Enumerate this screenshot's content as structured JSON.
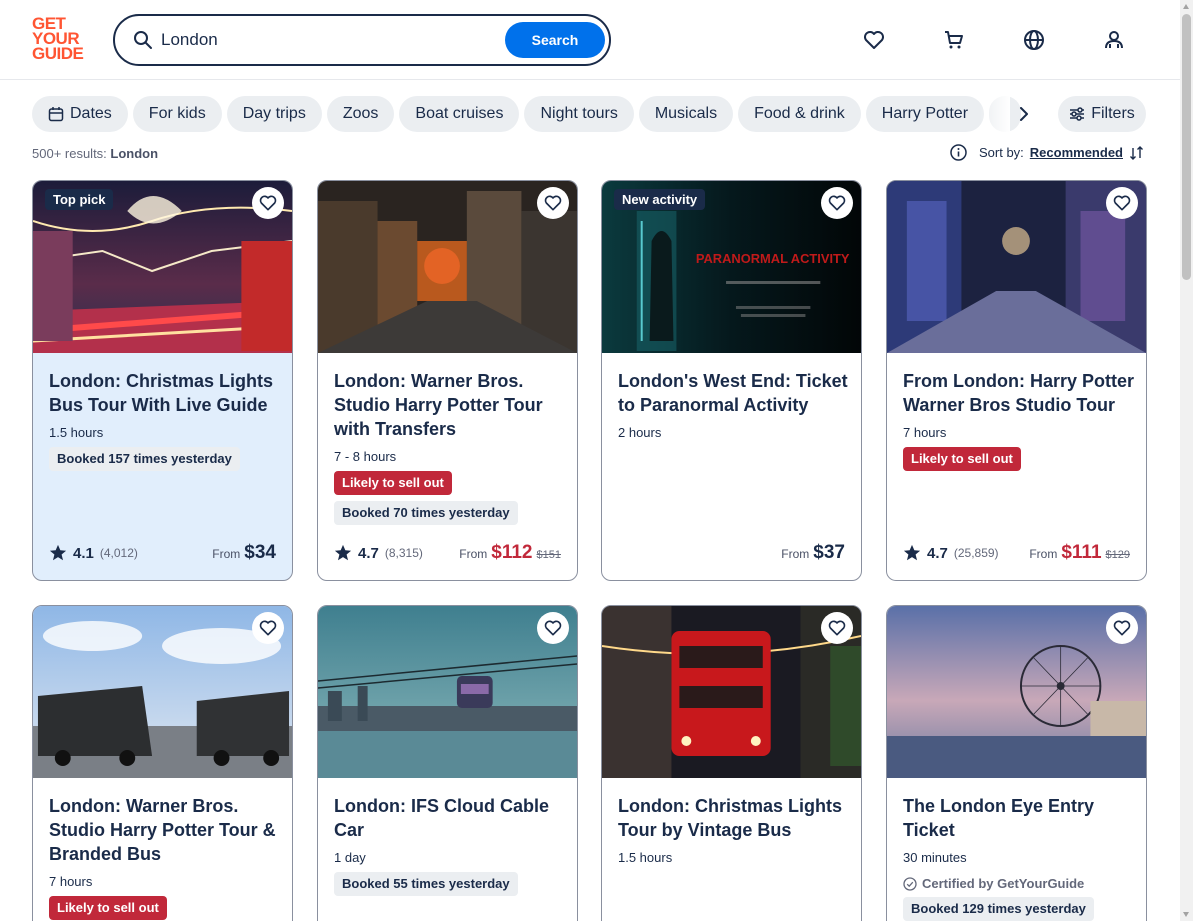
{
  "header": {
    "logo_lines": [
      "GET",
      "YOUR",
      "GUIDE"
    ],
    "search_value": "London",
    "search_button": "Search",
    "icons": [
      "heart-icon",
      "cart-icon",
      "globe-icon",
      "account-icon"
    ]
  },
  "chips": [
    {
      "label": "Dates",
      "icon": "calendar-icon"
    },
    {
      "label": "For kids"
    },
    {
      "label": "Day trips"
    },
    {
      "label": "Zoos"
    },
    {
      "label": "Boat cruises"
    },
    {
      "label": "Night tours"
    },
    {
      "label": "Musicals"
    },
    {
      "label": "Food & drink"
    },
    {
      "label": "Harry Potter"
    }
  ],
  "filters_label": "Filters",
  "results": {
    "count": "500+ results:",
    "query": "London"
  },
  "sort": {
    "label": "Sort by:",
    "value": "Recommended"
  },
  "colors": {
    "brand": "#ff5533",
    "primary": "#0071eb",
    "danger": "#c1283a",
    "text": "#1a2b49",
    "highlight": "#e1eefc"
  },
  "cards": [
    {
      "tag": "Top pick",
      "title": "London: Christmas Lights Bus Tour With Live Guide",
      "duration": "1.5 hours",
      "booked": "Booked 157 times yesterday",
      "rating": "4.1",
      "reviews": "(4,012)",
      "from": "From",
      "price": "$34"
    },
    {
      "title": "London: Warner Bros. Studio Harry Potter Tour with Transfers",
      "duration": "7 - 8 hours",
      "sellout": "Likely to sell out",
      "booked": "Booked 70 times yesterday",
      "rating": "4.7",
      "reviews": "(8,315)",
      "from": "From",
      "price": "$112",
      "old_price": "$151"
    },
    {
      "tag": "New activity",
      "title": "London's West End: Ticket to Paranormal Activity",
      "duration": "2 hours",
      "from": "From",
      "price": "$37",
      "poster_text": "PARANORMAL ACTIVITY"
    },
    {
      "title": "From London: Harry Potter Warner Bros Studio Tour",
      "duration": "7 hours",
      "sellout": "Likely to sell out",
      "rating": "4.7",
      "reviews": "(25,859)",
      "from": "From",
      "price": "$111",
      "old_price": "$129"
    },
    {
      "title": "London: Warner Bros. Studio Harry Potter Tour & Branded Bus",
      "duration": "7 hours",
      "sellout": "Likely to sell out"
    },
    {
      "title": "London: IFS Cloud Cable Car",
      "duration": "1 day",
      "booked": "Booked 55 times yesterday"
    },
    {
      "title": "London: Christmas Lights Tour by Vintage Bus",
      "duration": "1.5 hours"
    },
    {
      "title": "The London Eye Entry Ticket",
      "duration": "30 minutes",
      "certified": "Certified by GetYourGuide",
      "booked": "Booked 129 times yesterday"
    }
  ]
}
